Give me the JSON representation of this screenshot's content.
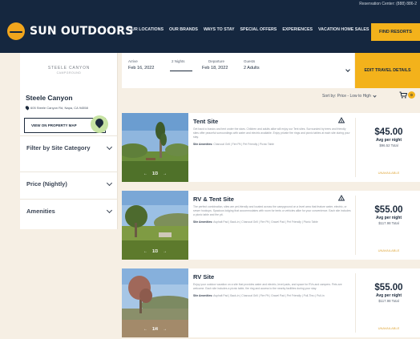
{
  "topbar": {
    "reservation": "Reservation Center: (888) 886-2"
  },
  "header": {
    "logo_text": "SUN OUTDOORS",
    "nav": [
      "OUR LOCATIONS",
      "OUR BRANDS",
      "WAYS TO STAY",
      "SPECIAL OFFERS",
      "EXPERIENCES",
      "VACATION HOME SALES"
    ],
    "find_button": "FIND RESORTS"
  },
  "sidebar": {
    "brand_logo": "STEELE CANYON",
    "brand_logo_sub": "CAMPGROUND",
    "park_name": "Steele Canyon",
    "address": "605 Steele Canyon Rd, Napa, CA 94558",
    "map_button": "VIEW ON PROPERTY MAP",
    "filters": [
      "Filter by Site Category",
      "Price (Nightly)",
      "Amenities"
    ]
  },
  "search": {
    "arrive_label": "Arrive",
    "arrive_value": "Feb 16, 2022",
    "nights": "2 Nights",
    "depart_label": "Departure",
    "depart_value": "Feb 18, 2022",
    "guests_label": "Guests",
    "guests_value": "2 Adults",
    "edit_button": "EDIT TRAVEL DETAILS"
  },
  "sort": {
    "label": "Sort by: Price - Low to High"
  },
  "cart": {
    "count": "0"
  },
  "sites": [
    {
      "title": "Tent Site",
      "description": "Get back to basics and tent under the stars. Children and adults alike will enjoy our Tent sites. Surrounded by trees and friendly sites offer peaceful surroundings with water and electric available. Enjoy private fire rings and picnic tables at each site during your stay.",
      "amenities_label": "Site Amenities:",
      "amenities": "Charcoal Grill | Fire Pit | Pet Friendly | Picnic Table",
      "carousel": "1/3",
      "price": "$45.00",
      "per_night": "Avg per night",
      "total": "$96.52 Total",
      "status": "UNAVAILABLE"
    },
    {
      "title": "RV & Tent Site",
      "description": "The perfect combination, sites are pet-friendly and located across the campground on a level area that feature water, electric, or sewer hookups. Spacious lodging that accommodates with room for tents or vehicles alike for your convenience. Each site includes a picnic table and fire pit.",
      "amenities_label": "Site Amenities:",
      "amenities": "Asphalt Pad | Back-in | Charcoal Grill | Fire Pit | Gravel Pad | Pet Friendly | Picnic Table",
      "carousel": "1/3",
      "price": "$55.00",
      "per_night": "Avg per night",
      "total": "$117.98 Total",
      "status": "UNAVAILABLE"
    },
    {
      "title": "RV Site",
      "description": "Enjoy your outdoor vacation on a site that provides water and electric, level pads, and space for RVs and campers. Pets are welcome. Each site includes a picnic table, fire ring and access to the nearby facilities during your stay.",
      "amenities_label": "Site Amenities:",
      "amenities": "Asphalt Pad | Back-in | Charcoal Grill | Fire Pit | Gravel Pad | Pet Friendly | Pull-Thru | Pull-in",
      "carousel": "1/4",
      "price": "$55.00",
      "per_night": "Avg per night",
      "total": "$117.98 Total",
      "status": "UNAVAILABLE"
    }
  ],
  "colors": {
    "navy": "#15273f",
    "accent": "#f3b21b",
    "background": "#f6efe4"
  }
}
